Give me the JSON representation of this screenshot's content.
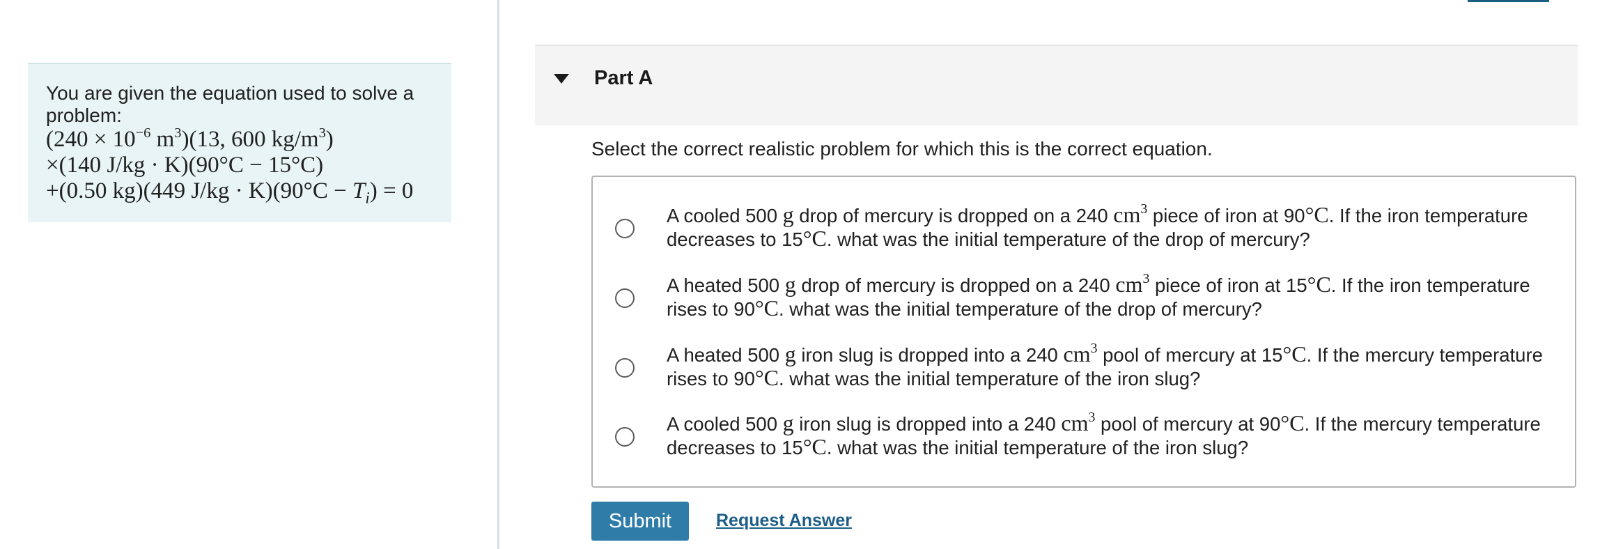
{
  "intro": {
    "text": "You are given the equation used to solve a problem:",
    "equation": [
      "(240 × 10⁻⁶ m³)(13, 600 kg/m³)",
      "×(140 J/kg · K)(90°C − 15°C)",
      "+(0.50 kg)(449 J/kg · K)(90°C − Tᵢ) = 0"
    ]
  },
  "part": {
    "title": "Part A"
  },
  "question": {
    "prompt": "Select the correct realistic problem for which this is the correct equation."
  },
  "options": [
    "A cooled 500 g drop of mercury is dropped on a 240 cm³ piece of iron at 90°C. If the iron temperature decreases to 15°C. what was the initial temperature of the drop of mercury?",
    "A heated 500 g drop of mercury is dropped on a 240 cm³ piece of iron at 15°C. If the iron temperature rises to 90°C. what was the initial temperature of the drop of mercury?",
    "A heated 500 g iron slug is dropped into a 240 cm³ pool of mercury at 15°C. If the mercury temperature rises to 90°C. what was the initial temperature of the iron slug?",
    "A cooled 500 g iron slug is dropped into a 240 cm³ pool of mercury at 90°C. If the mercury temperature decreases to 15°C. what was the initial temperature of the iron slug?"
  ],
  "actions": {
    "submit_label": "Submit",
    "request_answer_label": "Request Answer"
  },
  "colors": {
    "submit_bg": "#2f7ca8",
    "link": "#1c5e87",
    "intro_bg": "#e8f4f6"
  },
  "icons": {
    "part_toggle": "caret-down-icon",
    "option_radio": "radio-unchecked-icon"
  }
}
